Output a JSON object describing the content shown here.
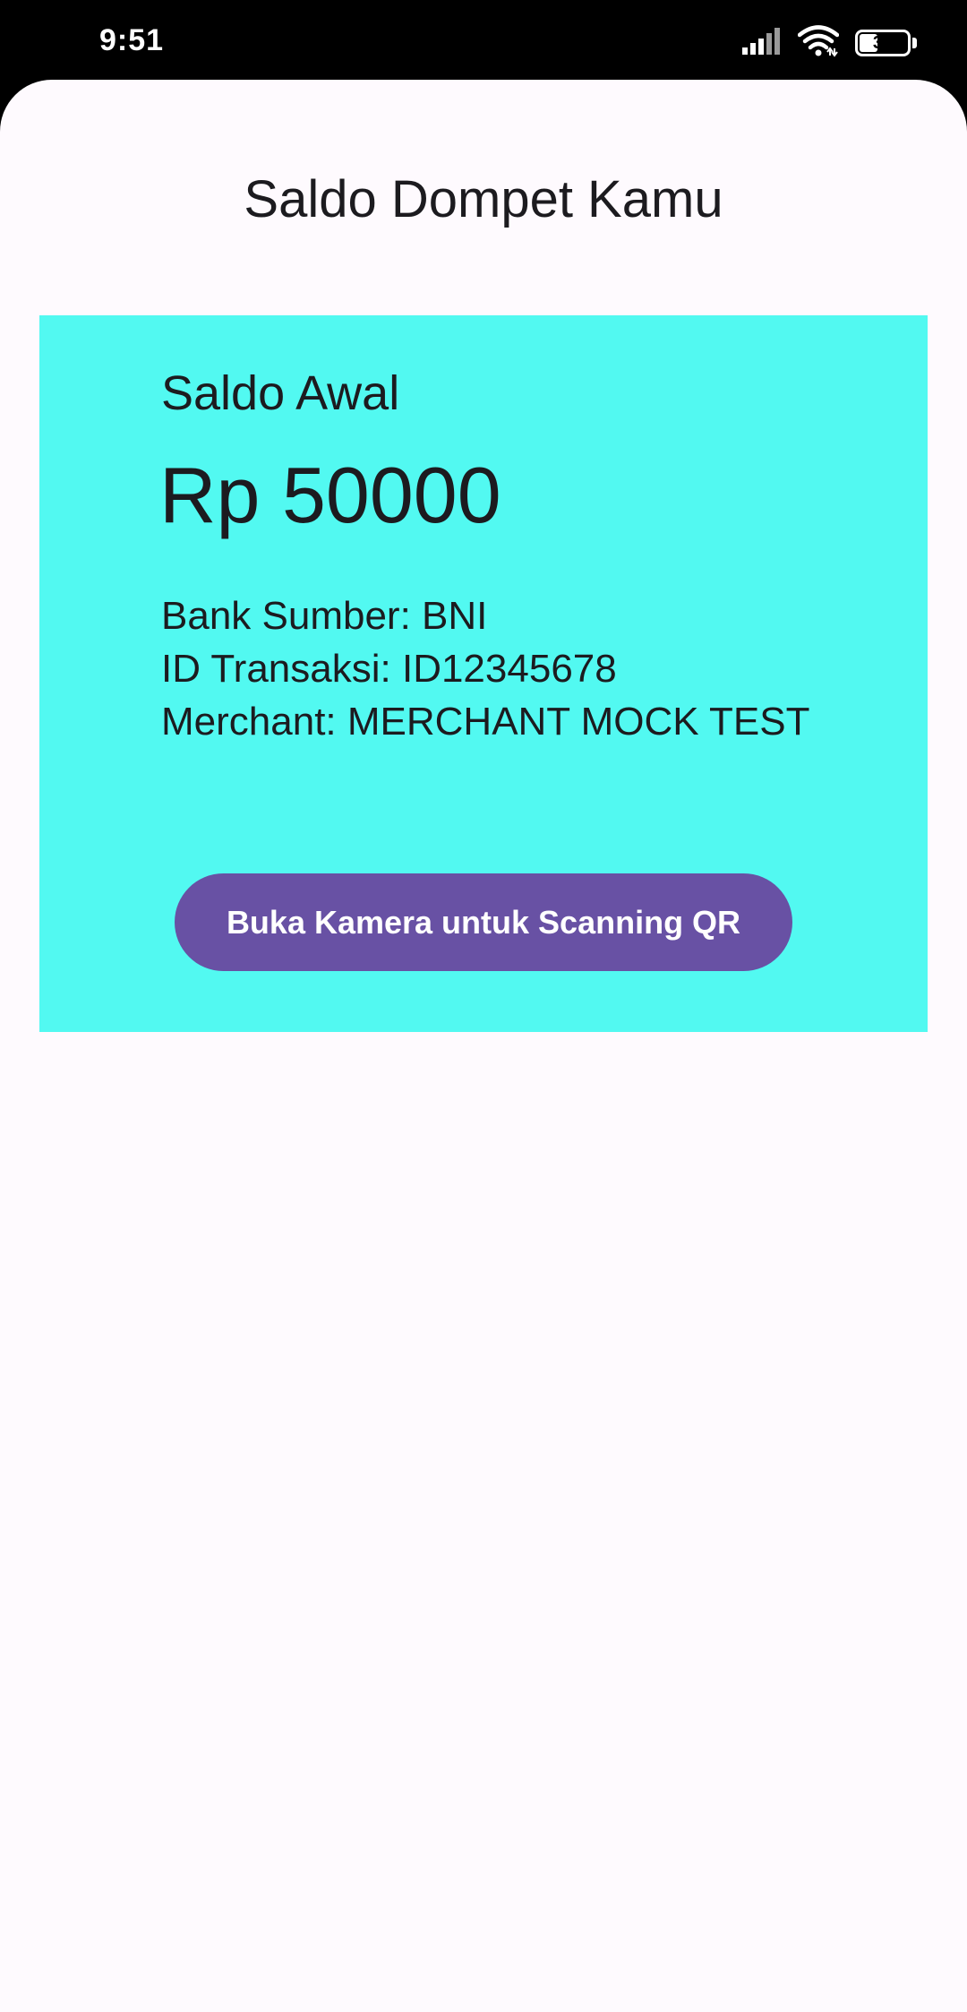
{
  "status_bar": {
    "time": "9:51",
    "battery_level": "39",
    "battery_fraction": 0.39,
    "icons": [
      "signal-icon",
      "wifi-icon",
      "battery-icon"
    ]
  },
  "page": {
    "title": "Saldo Dompet Kamu"
  },
  "wallet_card": {
    "label": "Saldo Awal",
    "balance": "Rp 50000",
    "bank_source": "Bank Sumber: BNI",
    "transaction_id": "ID Transaksi: ID12345678",
    "merchant": "Merchant: MERCHANT MOCK TEST",
    "scan_button_label": "Buka Kamera untuk Scanning QR"
  },
  "colors": {
    "card_background": "#52f9f1",
    "button_background": "#6851a4",
    "surface": "#fefafe",
    "status_bar": "#000000"
  }
}
